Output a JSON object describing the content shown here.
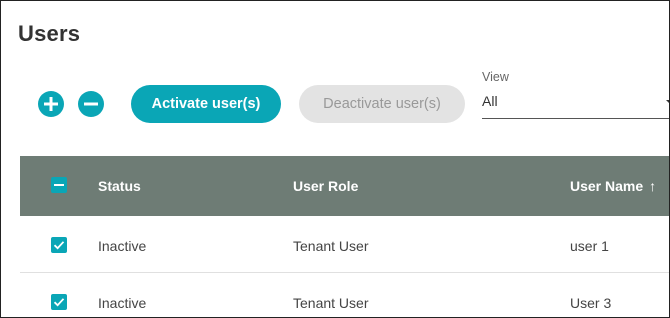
{
  "page": {
    "title": "Users"
  },
  "toolbar": {
    "add_icon": "plus-circle-icon",
    "remove_icon": "minus-circle-icon",
    "activate_label": "Activate user(s)",
    "deactivate_label": "Deactivate user(s)",
    "view_label": "View",
    "view_value": "All"
  },
  "table": {
    "headers": {
      "status": "Status",
      "role": "User Role",
      "name": "User Name",
      "sort_indicator": "↑"
    },
    "rows": [
      {
        "checked": true,
        "status": "Inactive",
        "role": "Tenant User",
        "name": "user 1"
      },
      {
        "checked": true,
        "status": "Inactive",
        "role": "Tenant User",
        "name": "User 3"
      }
    ]
  },
  "colors": {
    "accent": "#0aa6b6",
    "header_bg": "#6e7c75",
    "disabled_bg": "#e3e3e3"
  }
}
